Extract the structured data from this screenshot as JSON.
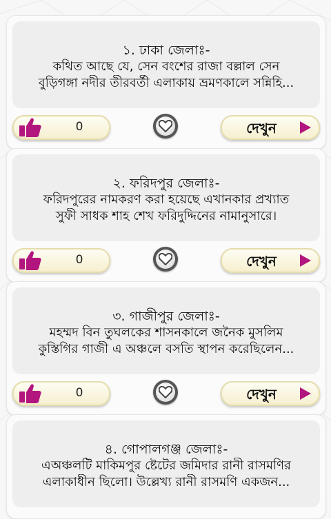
{
  "colors": {
    "accent": "#b2157e",
    "card": "#fbfbfb",
    "text_box": "#eeeeee"
  },
  "icons": {
    "like": "thumbs-up-icon",
    "favorite": "heart-icon",
    "open": "play-arrow-icon"
  },
  "items": [
    {
      "title": "১. ঢাকা জেলাঃ-",
      "line1": "কথিত আছে যে, সেন বংশের রাজা বল্লাল সেন",
      "line2": "বুড়িগঙ্গা নদীর তীরবর্তী এলাকায় ভ্রমণকালে সন্নিহি...",
      "likes": "0",
      "view_label": "দেখুন"
    },
    {
      "title": "২. ফরিদপুর জেলাঃ-",
      "line1": "ফরিদপুরের নামকরণ করা হয়েছে এখানকার প্রখ্যাত",
      "line2": "সুফী সাধক শাহ শেখ ফরিদুদ্দিনের নামানুসারে।",
      "likes": "0",
      "view_label": "দেখুন"
    },
    {
      "title": "৩. গাজীপুর জেলাঃ-",
      "line1": "মহম্মদ বিন তুঘলকের শাসনকালে জনৈক মুসলিম",
      "line2": "কুস্তিগির গাজী এ অঞ্চলে বসতি স্থাপন করেছিলেন...",
      "likes": "0",
      "view_label": "দেখুন"
    },
    {
      "title": "৪. গোপালগঞ্জ জেলাঃ-",
      "line1": "এঅঞ্চলটি মাকিমপুর ষ্টেটের জমিদার রানী রাসমণির",
      "line2": "এলাকাধীন ছিলো। উল্লেখ্য রানী রাসমণি একজন..."
    }
  ]
}
